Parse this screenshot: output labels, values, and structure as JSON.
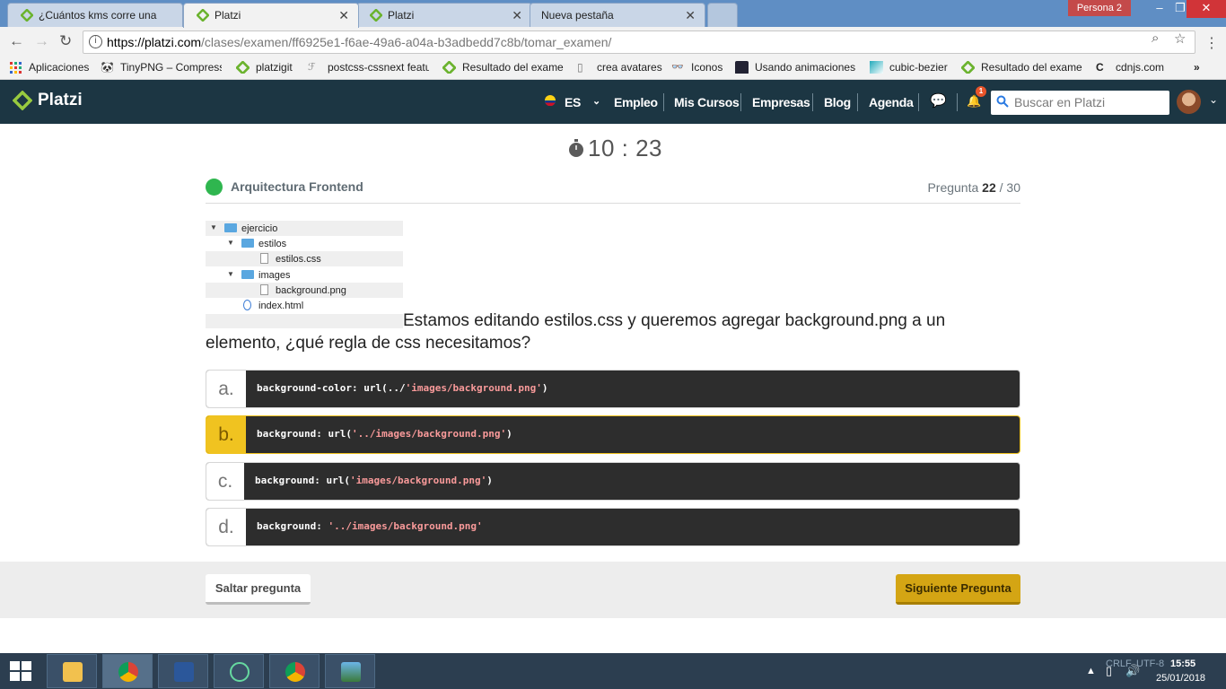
{
  "browser": {
    "tabs": [
      {
        "label": "¿Cuántos kms corre una",
        "active": false
      },
      {
        "label": "Platzi",
        "active": true
      },
      {
        "label": "Platzi",
        "active": false
      },
      {
        "label": "Nueva pestaña",
        "active": false
      }
    ],
    "profile": "Persona 2",
    "url_host": "https://platzi.com",
    "url_path": "/clases/examen/ff6925e1-f6ae-49a6-a04a-b3adbedd7c8b/tomar_examen/",
    "bookmarks": [
      "Aplicaciones",
      "TinyPNG – Compress",
      "platzigit",
      "postcss-cssnext featu",
      "Resultado del exame",
      "crea avatares",
      "Iconos",
      "Usando animaciones",
      "cubic-bezier",
      "Resultado del exame",
      "cdnjs.com"
    ]
  },
  "header": {
    "logo": "Platzi",
    "lang": "ES",
    "nav": [
      "Empleo",
      "Mis Cursos",
      "Empresas",
      "Blog",
      "Agenda"
    ],
    "notif_count": "1",
    "search_placeholder": "Buscar en Platzi"
  },
  "exam": {
    "timer": "10 : 23",
    "course": "Arquitectura Frontend",
    "question_label": "Pregunta",
    "question_current": "22",
    "question_total": "/ 30",
    "tree": [
      {
        "name": "ejercicio",
        "type": "folder",
        "level": 0,
        "expanded": true
      },
      {
        "name": "estilos",
        "type": "folder",
        "level": 1,
        "expanded": true
      },
      {
        "name": "estilos.css",
        "type": "file",
        "level": 2
      },
      {
        "name": "images",
        "type": "folder",
        "level": 1,
        "expanded": true
      },
      {
        "name": "background.png",
        "type": "file",
        "level": 2
      },
      {
        "name": "index.html",
        "type": "file",
        "level": 1
      }
    ],
    "question": "Estamos editando estilos.css y queremos agregar background.png a un elemento, ¿qué regla de css necesitamos?",
    "options": [
      {
        "letter": "a.",
        "code_pre": "background-color: url(../",
        "code_str": "'images/background.png'",
        "code_post": ")",
        "selected": false
      },
      {
        "letter": "b.",
        "code_pre": "background: url(",
        "code_str": "'../images/background.png'",
        "code_post": ")",
        "selected": true
      },
      {
        "letter": "c.",
        "code_pre": "background: url(",
        "code_str": "'images/background.png'",
        "code_post": ")",
        "selected": false
      },
      {
        "letter": "d.",
        "code_pre": "background: ",
        "code_str": "'../images/background.png'",
        "code_post": "",
        "selected": false
      }
    ],
    "skip_label": "Saltar pregunta",
    "next_label": "Siguiente Pregunta"
  },
  "taskbar": {
    "encoding1": "CRLF",
    "encoding2": "UTF-8",
    "time": "15:55",
    "date": "25/01/2018"
  },
  "colors": {
    "header_bg": "#1c3643",
    "accent": "#f0c320",
    "platzi_green": "#98ca3f"
  }
}
